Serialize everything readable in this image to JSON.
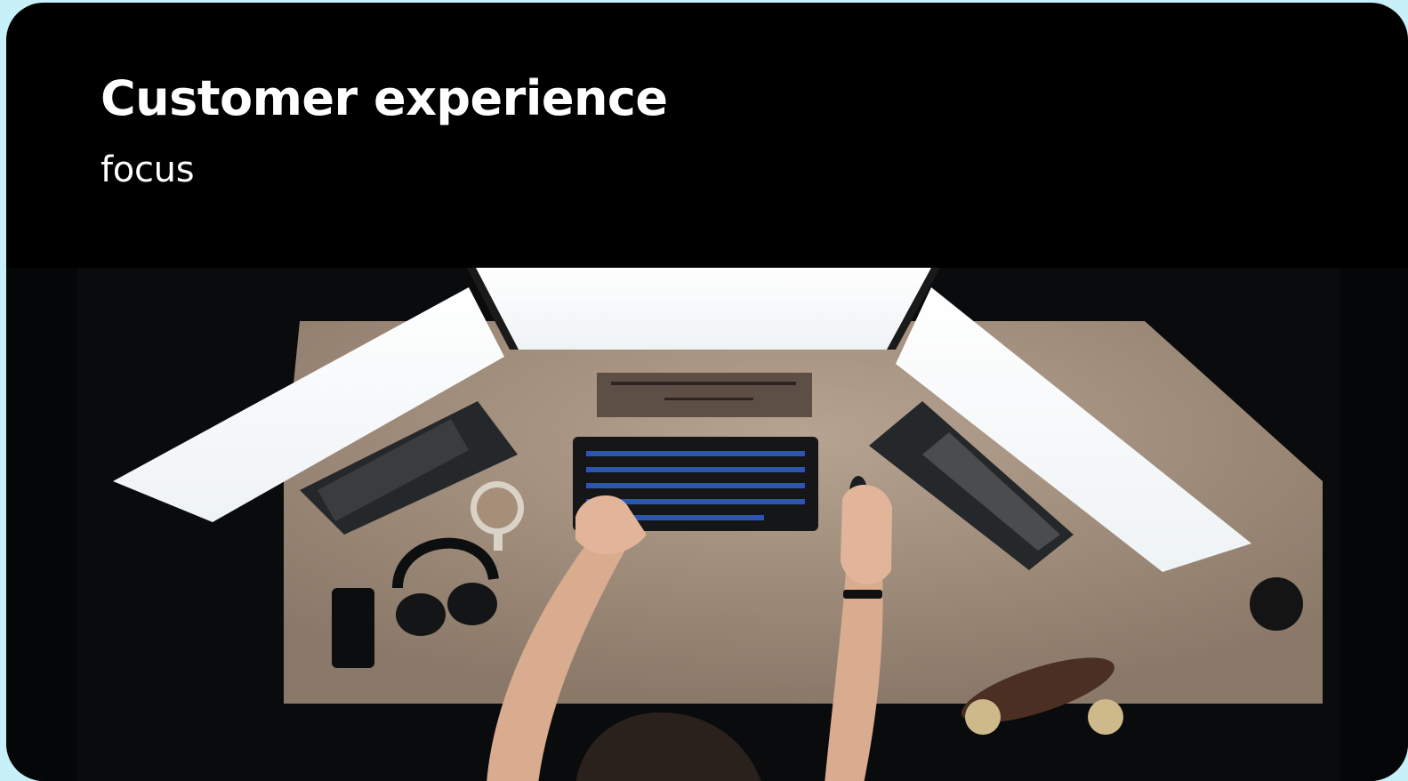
{
  "slide": {
    "title": "Customer experience",
    "subtitle": "focus"
  },
  "colors": {
    "page_background": "#c8f0f8",
    "card_background": "#000000",
    "text": "#ffffff"
  }
}
